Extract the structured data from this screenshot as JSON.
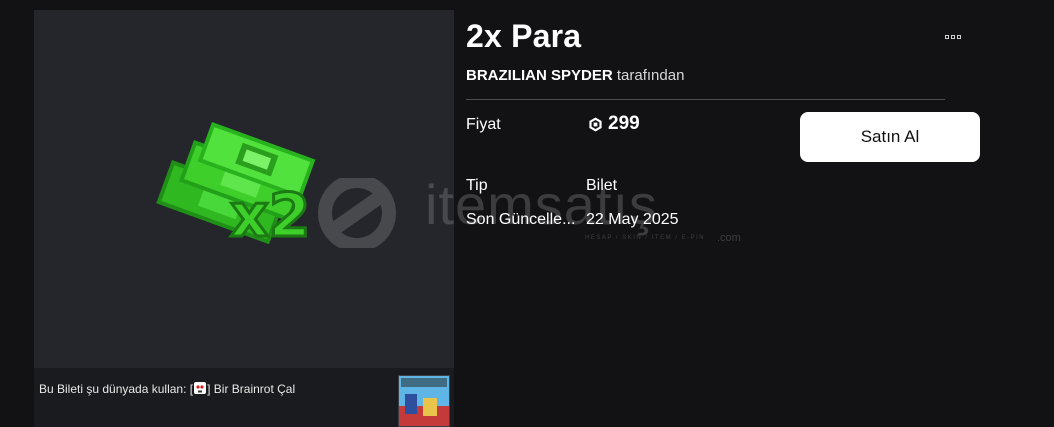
{
  "item": {
    "title": "2x Para",
    "creator_name": "BRAZILIAN SPYDER",
    "creator_suffix": " tarafından",
    "image_icon": "money-stack-x2-icon"
  },
  "details": {
    "price_label": "Fiyat",
    "price_value": "299",
    "price_icon": "robux-icon",
    "type_label": "Tip",
    "type_value": "Bilet",
    "updated_label": "Son Güncelle...",
    "updated_value": "22 May 2025"
  },
  "actions": {
    "buy_label": "Satın Al",
    "more_icon": "more-options-icon"
  },
  "experience": {
    "prefix": "Bu Bileti şu dünyada kullan: ",
    "name_open": "[",
    "name_close": "] Bir Brainrot Çal"
  },
  "watermark": {
    "text": "itemsatış",
    "sub": "HESAP / SKIN / ITEM / E-PIN",
    "com": ".com"
  },
  "colors": {
    "background": "#121215",
    "panel": "#24262c",
    "money_green": "#3ecf2a",
    "button": "#ffffff"
  }
}
